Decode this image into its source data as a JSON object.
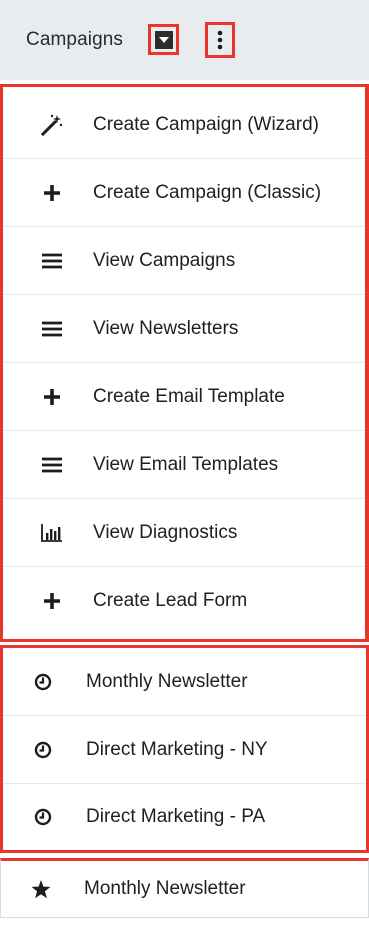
{
  "header": {
    "module_label": "Campaigns"
  },
  "actions_menu": [
    {
      "label": "Create Campaign (Wizard)",
      "icon": "magic-wand-icon"
    },
    {
      "label": "Create Campaign (Classic)",
      "icon": "plus-icon"
    },
    {
      "label": "View Campaigns",
      "icon": "list-icon"
    },
    {
      "label": "View Newsletters",
      "icon": "list-icon"
    },
    {
      "label": "Create Email Template",
      "icon": "plus-icon"
    },
    {
      "label": "View Email Templates",
      "icon": "list-icon"
    },
    {
      "label": "View Diagnostics",
      "icon": "bar-chart-icon"
    },
    {
      "label": "Create Lead Form",
      "icon": "plus-icon"
    }
  ],
  "recently_viewed": [
    {
      "label": "Monthly Newsletter",
      "icon": "clock-icon"
    },
    {
      "label": "Direct Marketing - NY",
      "icon": "clock-icon"
    },
    {
      "label": "Direct Marketing - PA",
      "icon": "clock-icon"
    }
  ],
  "favorites": [
    {
      "label": "Monthly Newsletter",
      "icon": "star-icon"
    }
  ],
  "colors": {
    "highlight": "#e8362c",
    "header_bg": "#e9ecef",
    "text": "#1f1f1f"
  }
}
